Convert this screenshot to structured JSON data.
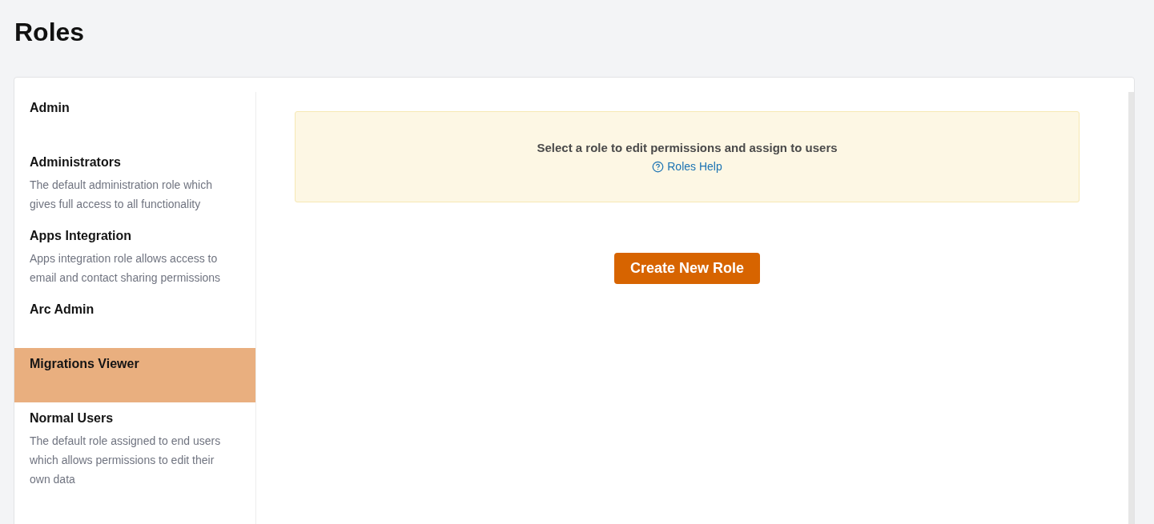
{
  "page": {
    "title": "Roles"
  },
  "roles": [
    {
      "name": "Admin",
      "selected": false
    },
    {
      "name": "Administrators",
      "description": "The default administration role which gives full access to all functionality",
      "selected": false
    },
    {
      "name": "Apps Integration",
      "description": "Apps integration role allows access to email and contact sharing permissions",
      "selected": false
    },
    {
      "name": "Arc Admin",
      "selected": false
    },
    {
      "name": "Migrations Viewer",
      "selected": true
    },
    {
      "name": "Normal Users",
      "description": "The default role assigned to end users which allows permissions to edit their own data",
      "selected": false
    }
  ],
  "notice": {
    "message": "Select a role to edit permissions and assign to users",
    "help_link": "Roles Help"
  },
  "create_button": {
    "label": "Create New Role"
  }
}
